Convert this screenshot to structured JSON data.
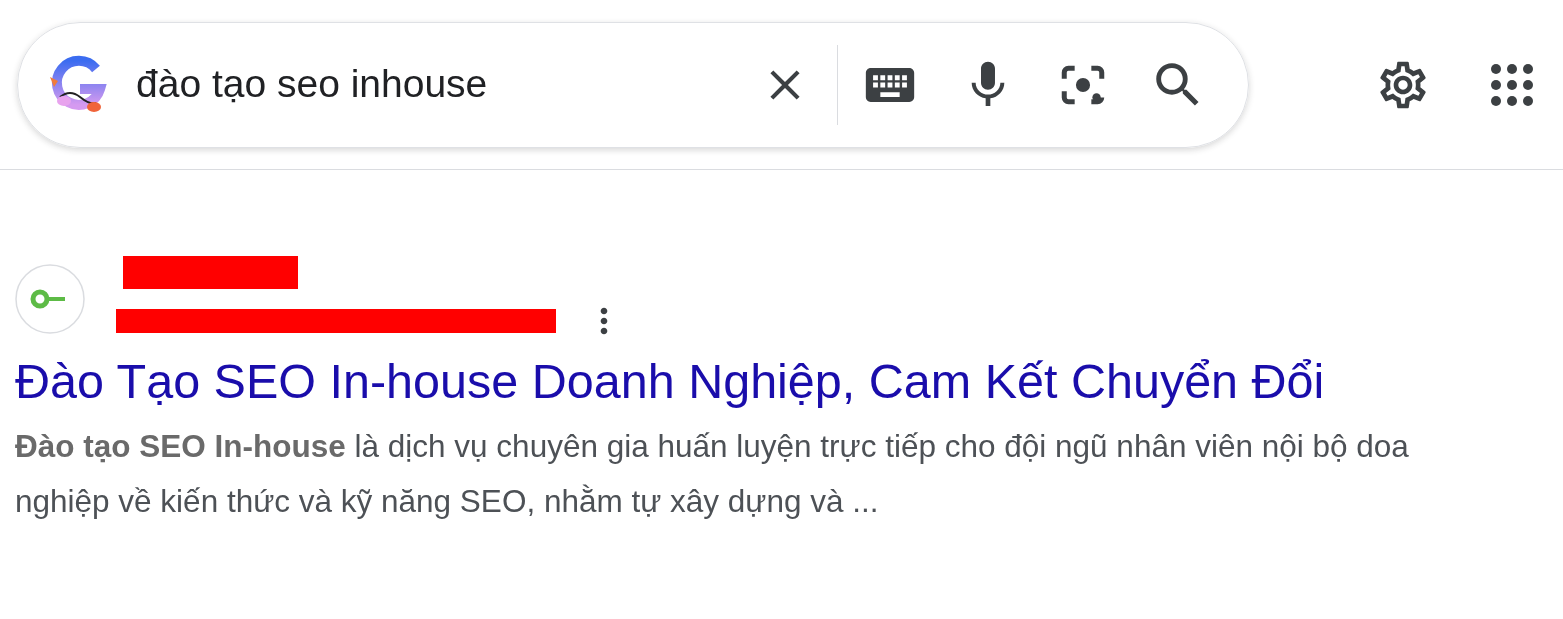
{
  "search": {
    "query": "đào tạo seo inhouse"
  },
  "result": {
    "title": "Đào Tạo SEO In-house Doanh Nghiệp, Cam Kết Chuyển Đổi",
    "snippet_lines": [
      "**Đào tạo SEO In-house** là dịch vụ chuyên gia huấn luyện trực tiếp cho đội ngũ nhân viên nội bộ doa",
      "nghiệp về kiến thức và kỹ năng SEO, nhằm tự xây dựng và ..."
    ]
  }
}
